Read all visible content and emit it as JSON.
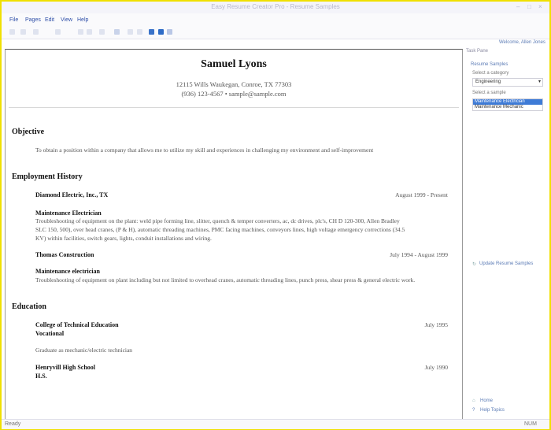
{
  "window": {
    "title": "Easy Resume Creator Pro - Resume Samples",
    "controls": [
      "–",
      "□",
      "×"
    ]
  },
  "menu": [
    "File",
    "Pages",
    "Edit",
    "View",
    "Help"
  ],
  "welcome": "Welcome, Allen Jones",
  "resume": {
    "name": "Samuel Lyons",
    "address": "12115 Wills Waukegan, Conroe, TX 77303",
    "contact": "(936) 123-4567  •  sample@sample.com",
    "objective_heading": "Objective",
    "objective_text": "To obtain a position within a company that allows me to utilize my skill and experiences in challenging my environment and self-improvement",
    "employment_heading": "Employment History",
    "jobs": [
      {
        "company": "Diamond Electric, Inc., TX",
        "dates": "August 1999 - Present",
        "title": "Maintenance Electrician",
        "desc1": "Troubleshooting of equipment on the plant: weld pipe forming line, slitter, quench & temper converters, ac, dc drives, plc's, CH D 120-300, Allen Bradley",
        "desc2": "SLC 150, 500), over head cranes, (P & H), automatic threading machines, PMC facing machines, conveyors lines, high voltage emergency corrections (34.5",
        "desc3": "KV) within facilities, switch gears, lights, conduit installations and wiring."
      },
      {
        "company": "Thomas Construction",
        "dates": "July 1994 - August 1999",
        "title": "Maintenance electrician",
        "desc1": "Troubleshooting of equipment on plant including but not limited to overhead cranes, automatic threading lines, punch press, shear press & general electric work."
      }
    ],
    "education_heading": "Education",
    "schools": [
      {
        "name": "College of Technical Education",
        "dates": "July 1995",
        "detail": "Vocational",
        "note": "Graduate as mechanic/electric technician"
      },
      {
        "name": "Henryvill High School",
        "dates": "July 1990",
        "detail": "H.S."
      }
    ]
  },
  "task_pane": {
    "title": "Task Pane",
    "section": "Resume Samples",
    "category_label": "Select a category",
    "category_value": "Engineering",
    "sample_label": "Select a sample",
    "samples": [
      "Maintenance Electrician",
      "Maintenance Mechanic"
    ],
    "update_link": "Update Resume Samples",
    "home_link": "Home",
    "help_link": "Help Topics"
  },
  "status": {
    "left": "Ready",
    "right": "NUM"
  }
}
